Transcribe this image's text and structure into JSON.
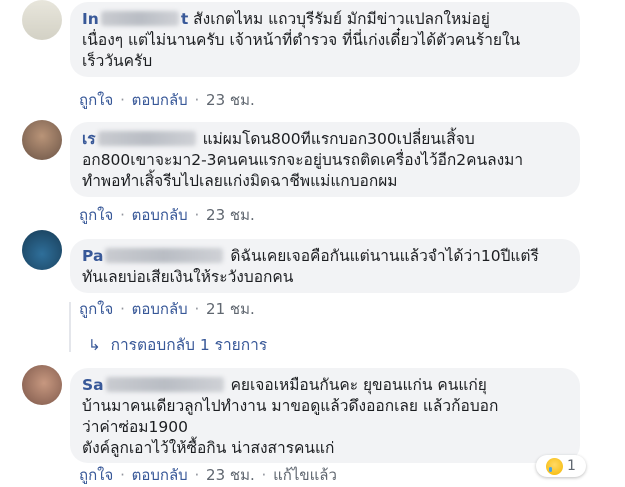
{
  "comments": [
    {
      "author_visible": "In",
      "author_tail": "t",
      "lines": [
        "สังเกตไหม แถวบุรีรัมย์ มักมีข่าวแปลกใหม่อยู่",
        "เนื่องๆ แต่ไม่นานครับ เจ้าหน้าที่ตำรวจ ที่นี่เก่งเดี๋ยวได้ตัวคนร้ายใน",
        "เร็ววันครับ"
      ],
      "like": "ถูกใจ",
      "reply": "ตอบกลับ",
      "time": "23 ชม."
    },
    {
      "author_visible": "เร",
      "lines": [
        "แม่ผมโดน800ทีแรกบอก300เปลี่ยนเสิ้จบ",
        "อก800เขาจะมา2-3คนคนแรกจะอยู่บนรถติดเครื่องไว้อีก2คนลงมา",
        "ทำพอทำเสิ้จรีบไปเลยแก่งมิดฉาชีพแม่แกบอกผม"
      ],
      "like": "ถูกใจ",
      "reply": "ตอบกลับ",
      "time": "23 ชม."
    },
    {
      "author_visible": "Pa",
      "lines": [
        "ดิฉันเคยเจอคือกันแต่นานแล้วจำได้ว่า10ปีแต่รี",
        "ทันเลยบ่อเสียเงินให้ระวังบอกคน"
      ],
      "like": "ถูกใจ",
      "reply": "ตอบกลับ",
      "time": "21 ชม."
    },
    {
      "author_visible": "Sa",
      "lines": [
        "คยเจอเหมือนกันคะ ยุขอนแก่น คนแก่ยุ",
        "บ้านมาคนเดียวลูกไปทำงาน มาขอดูแล้วดึงออกเลย แล้วก้อบอก",
        "ว่าค่าซ่อม1900",
        "ตังค์ลูกเอาไว้ให้ซื้อกิน น่าสงสารคนแก่"
      ],
      "like": "ถูกใจ",
      "reply": "ตอบกลับ",
      "time": "23 ชม.",
      "edited": "แก้ไขแล้ว",
      "reaction_count": "1"
    }
  ],
  "replies_link": "การตอบกลับ 1 รายการ",
  "colors": {
    "link": "#385898",
    "bubble": "#f2f3f5",
    "meta": "#606770"
  },
  "icons": {
    "replies": "reply-arrow-icon",
    "reaction": "sad-emoji-icon"
  }
}
